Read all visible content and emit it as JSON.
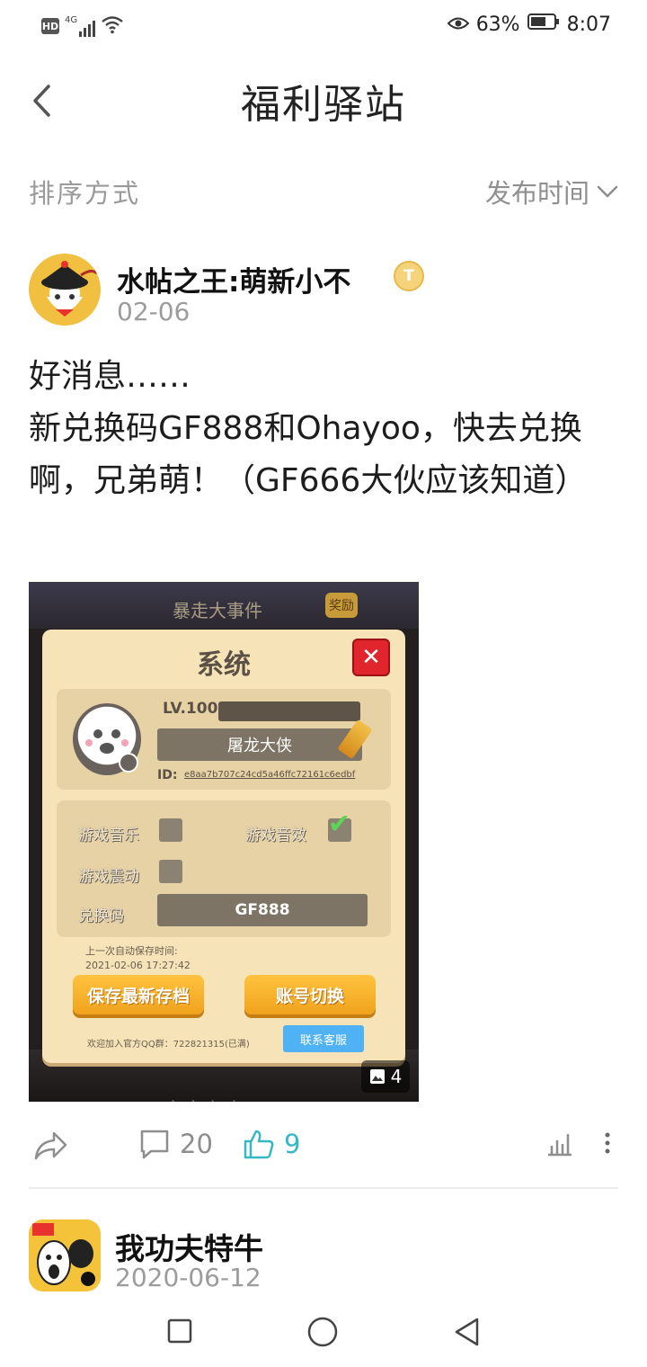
{
  "status_bar": {
    "left_icons": [
      "hd-icon",
      "4g-signal-icon",
      "wifi-icon"
    ],
    "hd": "HD",
    "network": "4G",
    "battery_percent": "63%",
    "time": "8:07"
  },
  "header": {
    "title": "福利驿站"
  },
  "sort": {
    "label": "排序方式",
    "selected": "发布时间"
  },
  "post": {
    "author": "水帖之王:萌新小不",
    "badge": "T",
    "date": "02-06",
    "body": "好消息……\n新兑换码GF888和Ohayoo，快去兑换啊，兄弟萌！（GF666大伙应该知道）",
    "image": {
      "bg_title": "暴走大事件",
      "bg_reward": "奖励",
      "bg_bottom": "亦寇亦瘟",
      "dialog_title": "系统",
      "level": "LV.100",
      "nickname": "屠龙大侠",
      "id_label": "ID:",
      "id_value": "e8aa7b707c24cd5a46ffc72161c6edbf",
      "settings": {
        "music": "游戏音乐",
        "sound": "游戏音效",
        "vibration": "游戏震动",
        "code_label": "兑换码",
        "code_value": "GF888"
      },
      "save_info_line1": "上一次自动保存时间:",
      "save_info_line2": "2021-02-06 17:27:42",
      "save_button": "保存最新存档",
      "switch_button": "账号切换",
      "qq_text": "欢迎加入官方QQ群：722821315(已满)",
      "service_button": "联系客服",
      "image_count": "4"
    },
    "actions": {
      "comments": "20",
      "likes": "9"
    }
  },
  "next_post": {
    "author": "我功夫特牛",
    "date": "2020-06-12"
  },
  "colors": {
    "accent_like": "#36b8c4",
    "muted_text": "#9c9c9c",
    "orange_button": "#f0a21c"
  }
}
